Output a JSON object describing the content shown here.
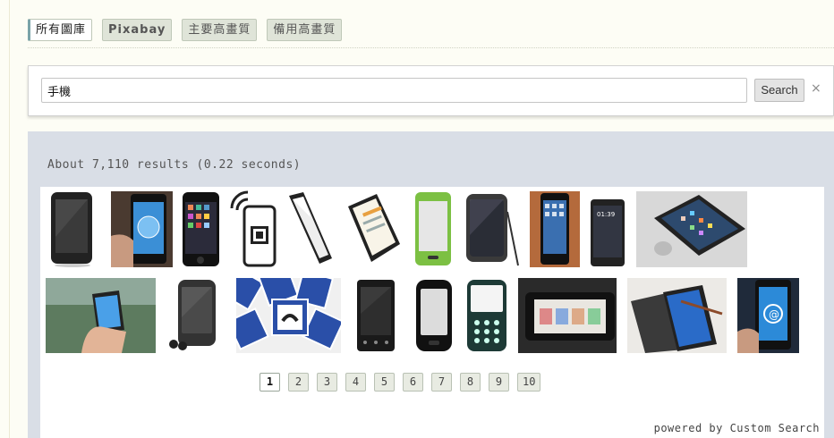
{
  "tabs": [
    {
      "label": "所有圖庫",
      "active": true
    },
    {
      "label": "Pixabay",
      "active": false
    },
    {
      "label": "主要高畫質",
      "active": false
    },
    {
      "label": "備用高畫質",
      "active": false
    }
  ],
  "search": {
    "value": "手機",
    "button_label": "Search",
    "clear_icon": "×"
  },
  "results": {
    "info": "About 7,110 results (0.22 seconds)"
  },
  "pagination": [
    "1",
    "2",
    "3",
    "4",
    "5",
    "6",
    "7",
    "8",
    "9",
    "10"
  ],
  "current_page": "1",
  "footer": {
    "powered": "powered by Custom Search"
  },
  "thumbnails": [
    "phone-black-glossy",
    "phone-in-hand-globe",
    "iphone-apps",
    "phone-wifi-qr",
    "phone-black-slanted",
    "tablet-web-page",
    "phone-green-lime",
    "tablet-stylus",
    "iphone-home-screen",
    "phone-lockscreen-time",
    "iphone-on-desk",
    "hand-holding-iphone-outdoor",
    "mp3-player-earbuds",
    "phone-sign-pattern",
    "black-phone-buttons",
    "black-phone-front",
    "feature-phone-keypad",
    "phone-landscape-photos",
    "phone-in-flip-case-pen",
    "hand-holding-phone-email"
  ],
  "colors": {
    "accent": "#7aa3a8",
    "panel": "#d9dee6",
    "tab": "#dfe4d8"
  }
}
